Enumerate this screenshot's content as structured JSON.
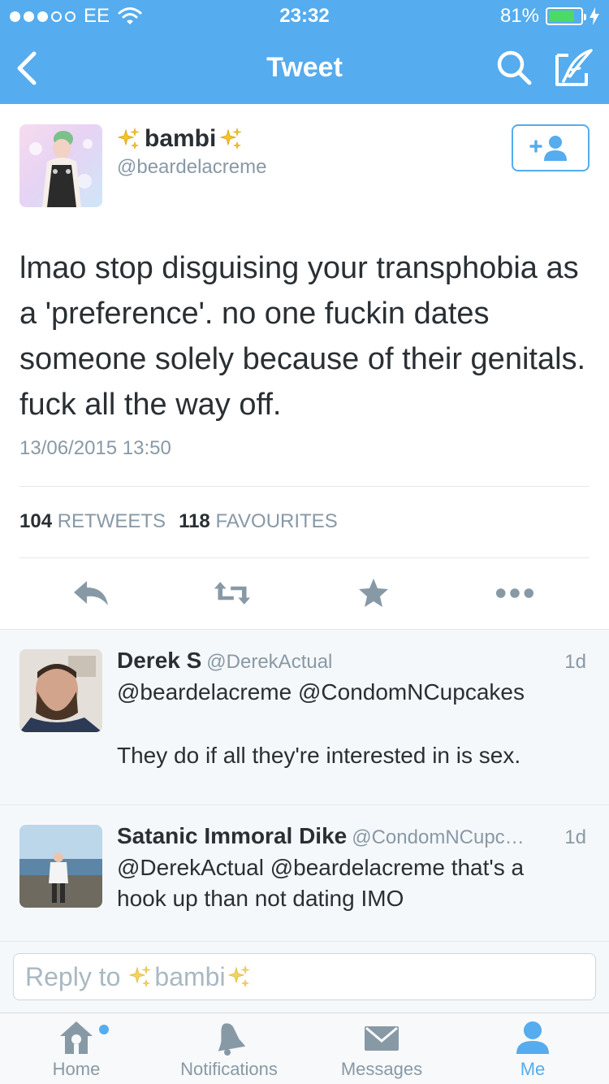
{
  "status_bar": {
    "carrier": "EE",
    "time": "23:32",
    "battery": "81%",
    "battery_level": 0.81
  },
  "nav": {
    "title": "Tweet"
  },
  "tweet": {
    "name": "bambi",
    "handle": "@beardelacreme",
    "text": "lmao stop disguising your transphobia as a 'preference'. no one fuckin dates someone solely because of their genitals. fuck all the way off.",
    "timestamp": "13/06/2015 13:50",
    "retweets_count": "104",
    "retweets_label": "RETWEETS",
    "favourites_count": "118",
    "favourites_label": "FAVOURITES"
  },
  "replies": [
    {
      "name": "Derek S",
      "handle": "@DerekActual",
      "time": "1d",
      "mentions": "@beardelacreme @CondomNCupcakes",
      "text": "They do if all they're interested in is sex."
    },
    {
      "name": "Satanic Immoral Dike",
      "handle": "@CondomNCupc…",
      "time": "1d",
      "text": "@DerekActual @beardelacreme that's a hook up than not dating IMO"
    }
  ],
  "reply_box": {
    "prefix": "Reply to",
    "name": "bambi"
  },
  "tabbar": {
    "items": [
      {
        "label": "Home"
      },
      {
        "label": "Notifications"
      },
      {
        "label": "Messages"
      },
      {
        "label": "Me"
      }
    ]
  },
  "colors": {
    "brand": "#55acee",
    "text": "#292f33",
    "muted": "#8899a6",
    "icon": "#8899a6"
  }
}
